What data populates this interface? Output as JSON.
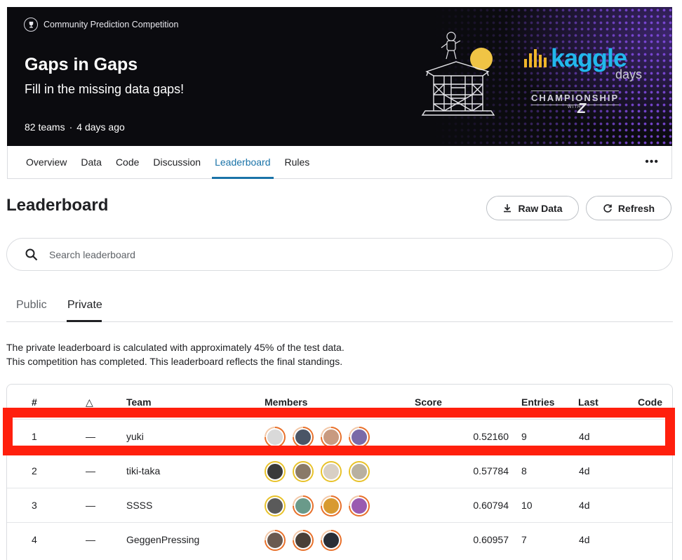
{
  "banner": {
    "competition_type": "Community Prediction Competition",
    "title": "Gaps in Gaps",
    "subtitle": "Fill in the missing data gaps!",
    "teams": "82 teams",
    "separator": "·",
    "time_ago": "4 days ago",
    "brand": {
      "kaggle": "kaggle",
      "days": "days",
      "championship": "CHAMPIONSHIP",
      "with": "WITH",
      "z": "Z"
    }
  },
  "nav": {
    "items": [
      {
        "label": "Overview"
      },
      {
        "label": "Data"
      },
      {
        "label": "Code"
      },
      {
        "label": "Discussion"
      },
      {
        "label": "Leaderboard"
      },
      {
        "label": "Rules"
      }
    ],
    "active": "Leaderboard",
    "more": "•••"
  },
  "header": {
    "title": "Leaderboard",
    "raw_data_label": "Raw Data",
    "refresh_label": "Refresh"
  },
  "search": {
    "placeholder": "Search leaderboard"
  },
  "tabs": {
    "public": "Public",
    "private": "Private",
    "active": "Private"
  },
  "notes": {
    "line1": "The private leaderboard is calculated with approximately 45% of the test data.",
    "line2": "This competition has completed. This leaderboard reflects the final standings."
  },
  "table": {
    "columns": {
      "rank": "#",
      "delta": "△",
      "team": "Team",
      "members": "Members",
      "score": "Score",
      "entries": "Entries",
      "last": "Last",
      "code": "Code"
    },
    "rows": [
      {
        "rank": "1",
        "delta": "—",
        "team": "yuki",
        "score": "0.52160",
        "entries": "9",
        "last": "4d",
        "member_count": 4
      },
      {
        "rank": "2",
        "delta": "—",
        "team": "tiki-taka",
        "score": "0.57784",
        "entries": "8",
        "last": "4d",
        "member_count": 4
      },
      {
        "rank": "3",
        "delta": "—",
        "team": "SSSS",
        "score": "0.60794",
        "entries": "10",
        "last": "4d",
        "member_count": 4
      },
      {
        "rank": "4",
        "delta": "—",
        "team": "GeggenPressing",
        "score": "0.60957",
        "entries": "7",
        "last": "4d",
        "member_count": 3
      }
    ]
  },
  "colors": {
    "accent": "#1a73a8",
    "highlight": "#ff1f0d",
    "avatar_ring_orange": "#e8702a",
    "avatar_ring_gold": "#e8c22a"
  }
}
